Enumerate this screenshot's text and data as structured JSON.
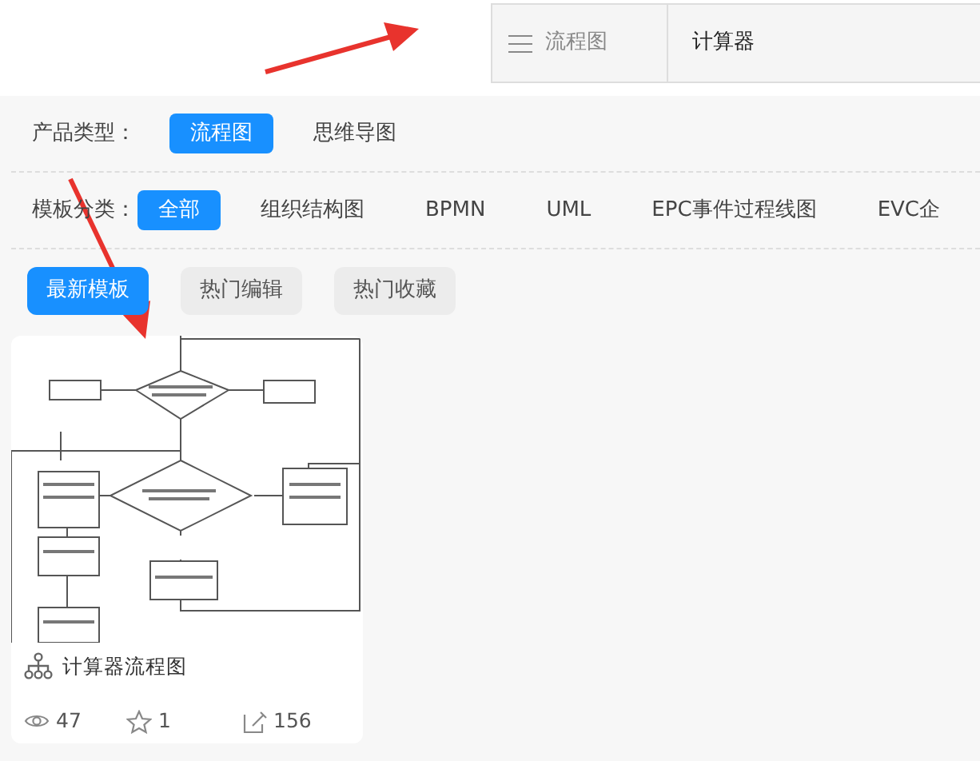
{
  "tabs": [
    {
      "label": "流程图",
      "kind": "menu",
      "selected": false
    },
    {
      "label": "计算器",
      "kind": "plain",
      "selected": true
    }
  ],
  "filters": [
    {
      "label": "产品类型：",
      "options": [
        {
          "label": "流程图",
          "selected": true
        },
        {
          "label": "思维导图",
          "selected": false
        }
      ]
    },
    {
      "label": "模板分类：",
      "options": [
        {
          "label": "全部",
          "selected": true
        },
        {
          "label": "组织结构图",
          "selected": false
        },
        {
          "label": "BPMN",
          "selected": false
        },
        {
          "label": "UML",
          "selected": false
        },
        {
          "label": "EPC事件过程线图",
          "selected": false
        },
        {
          "label": "EVC企",
          "selected": false
        }
      ]
    }
  ],
  "sort_buttons": [
    {
      "label": "最新模板",
      "selected": true
    },
    {
      "label": "热门编辑",
      "selected": false
    },
    {
      "label": "热门收藏",
      "selected": false
    }
  ],
  "templates": [
    {
      "title": "计算器流程图",
      "views": "47",
      "stars": "1",
      "edits": "156"
    }
  ]
}
